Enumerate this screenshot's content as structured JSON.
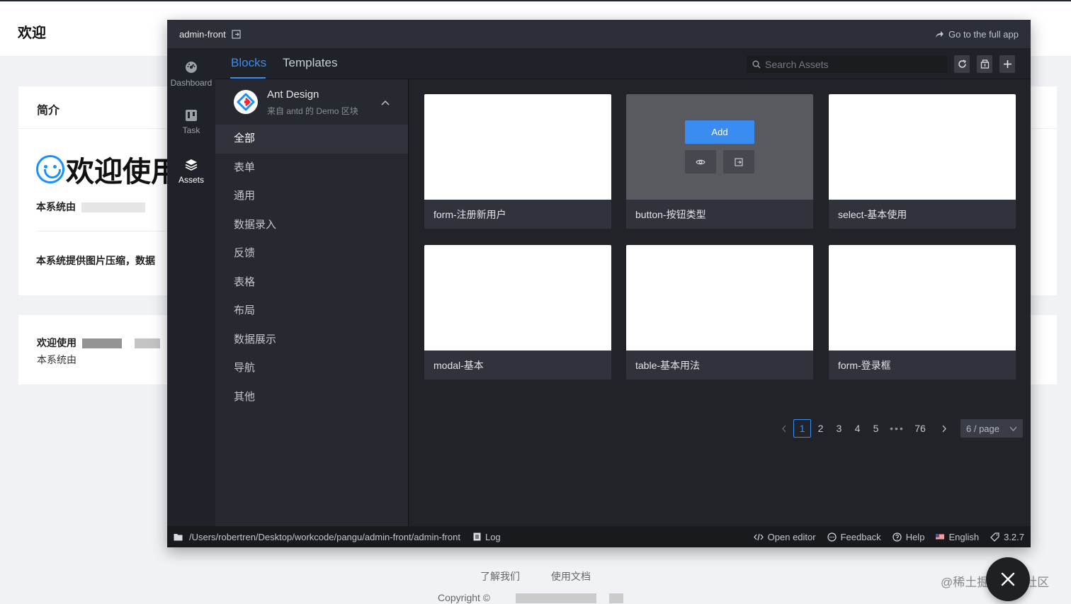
{
  "background": {
    "header_title": "欢迎",
    "card1_title": "简介",
    "welcome_heading": "欢迎使用",
    "desc_line1": "本系统由",
    "desc_line2": "本系统提供图片压缩，数据",
    "card2_line1": "欢迎使用",
    "card2_line2": "本系统由",
    "footer_links": [
      "了解我们",
      "使用文档"
    ],
    "copyright": "Copyright ©"
  },
  "watermark": "@稀土掘金技术社区",
  "panel": {
    "project_name": "admin-front",
    "full_app_label": "Go to the full app",
    "sidebar": [
      {
        "label": "Dashboard",
        "icon": "dashboard-icon"
      },
      {
        "label": "Task",
        "icon": "task-icon"
      },
      {
        "label": "Assets",
        "icon": "layers-icon"
      }
    ],
    "tabs": [
      {
        "label": "Blocks",
        "active": true
      },
      {
        "label": "Templates",
        "active": false
      }
    ],
    "search": {
      "placeholder": "Search Assets",
      "value": ""
    },
    "library": {
      "name": "Ant Design",
      "subtitle": "来自 antd 的 Demo 区块"
    },
    "categories": [
      "全部",
      "表单",
      "通用",
      "数据录入",
      "反馈",
      "表格",
      "布局",
      "数据展示",
      "导航",
      "其他"
    ],
    "active_category": "全部",
    "cards": [
      {
        "title": "form-注册新用户"
      },
      {
        "title": "button-按钮类型",
        "hover": true
      },
      {
        "title": "select-基本使用"
      },
      {
        "title": "modal-基本"
      },
      {
        "title": "table-基本用法"
      },
      {
        "title": "form-登录框"
      }
    ],
    "add_label": "Add",
    "pagination": {
      "pages": [
        "1",
        "2",
        "3",
        "4",
        "5"
      ],
      "ellipsis": "•••",
      "last_page": "76",
      "current": 1,
      "page_size_label": "6 / page"
    },
    "statusbar": {
      "path": "/Users/robertren/Desktop/workcode/pangu/admin-front/admin-front",
      "log": "Log",
      "open_editor": "Open editor",
      "feedback": "Feedback",
      "help": "Help",
      "language": "English",
      "version": "3.2.7"
    }
  },
  "colors": {
    "accent": "#3b8cf0",
    "panel_bg": "#202229",
    "topbar_bg": "#2c2f38",
    "statusbar_bg": "#191a1e"
  }
}
